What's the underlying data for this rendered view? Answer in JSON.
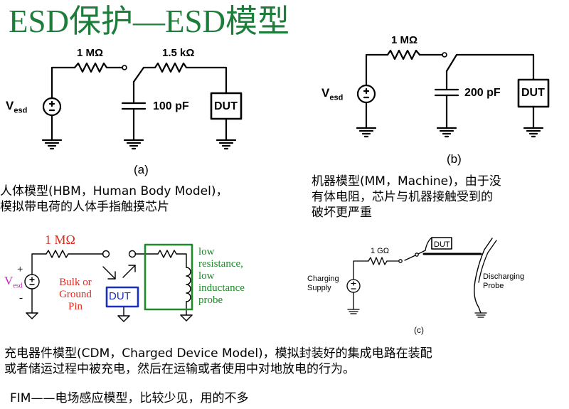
{
  "title": "ESD保护—ESD模型",
  "circuit_a": {
    "r1": "1 MΩ",
    "r2": "1.5 kΩ",
    "cap": "100 pF",
    "source_main": "V",
    "source_sub": "esd",
    "dut": "DUT",
    "caption": "(a)"
  },
  "circuit_b": {
    "r1": "1 MΩ",
    "cap": "200 pF",
    "source_main": "V",
    "source_sub": "esd",
    "dut": "DUT",
    "caption": "(b)"
  },
  "circuit_cdm": {
    "r1": "1 MΩ",
    "source_main": "V",
    "source_sub": "esd",
    "plus": "+",
    "minus": "-",
    "bulk_label": [
      "Bulk or",
      "Ground",
      "Pin"
    ],
    "dut": "DUT",
    "probe_label": [
      "low",
      "resistance,",
      "low",
      "inductance",
      "probe"
    ]
  },
  "circuit_c": {
    "r1": "1 GΩ",
    "dut": "DUT",
    "supply_label": [
      "Charging",
      "Supply"
    ],
    "probe_label": [
      "Discharging",
      "Probe"
    ],
    "caption": "(c)"
  },
  "text": {
    "hbm": [
      "人体模型(HBM，Human Body Model)，",
      "模拟带电荷的人体手指触摸芯片"
    ],
    "mm": [
      "机器模型(MM，Machine)，由于没",
      "有体电阻，芯片与机器接触受到的",
      "破坏更严重"
    ],
    "cdm": [
      "充电器件模型(CDM，Charged Device Model)，模拟封装好的集成电路在装配",
      "或者储运过程中被充电，然后在运输或者使用中对地放电的行为。"
    ],
    "fim": "FIM——电场感应模型，比较少见，用的不多"
  },
  "colors": {
    "title": "#1f7d3c",
    "red": "#e0281e",
    "blue": "#1a2fc0",
    "green": "#1e8a2a",
    "magenta": "#d020c8"
  }
}
